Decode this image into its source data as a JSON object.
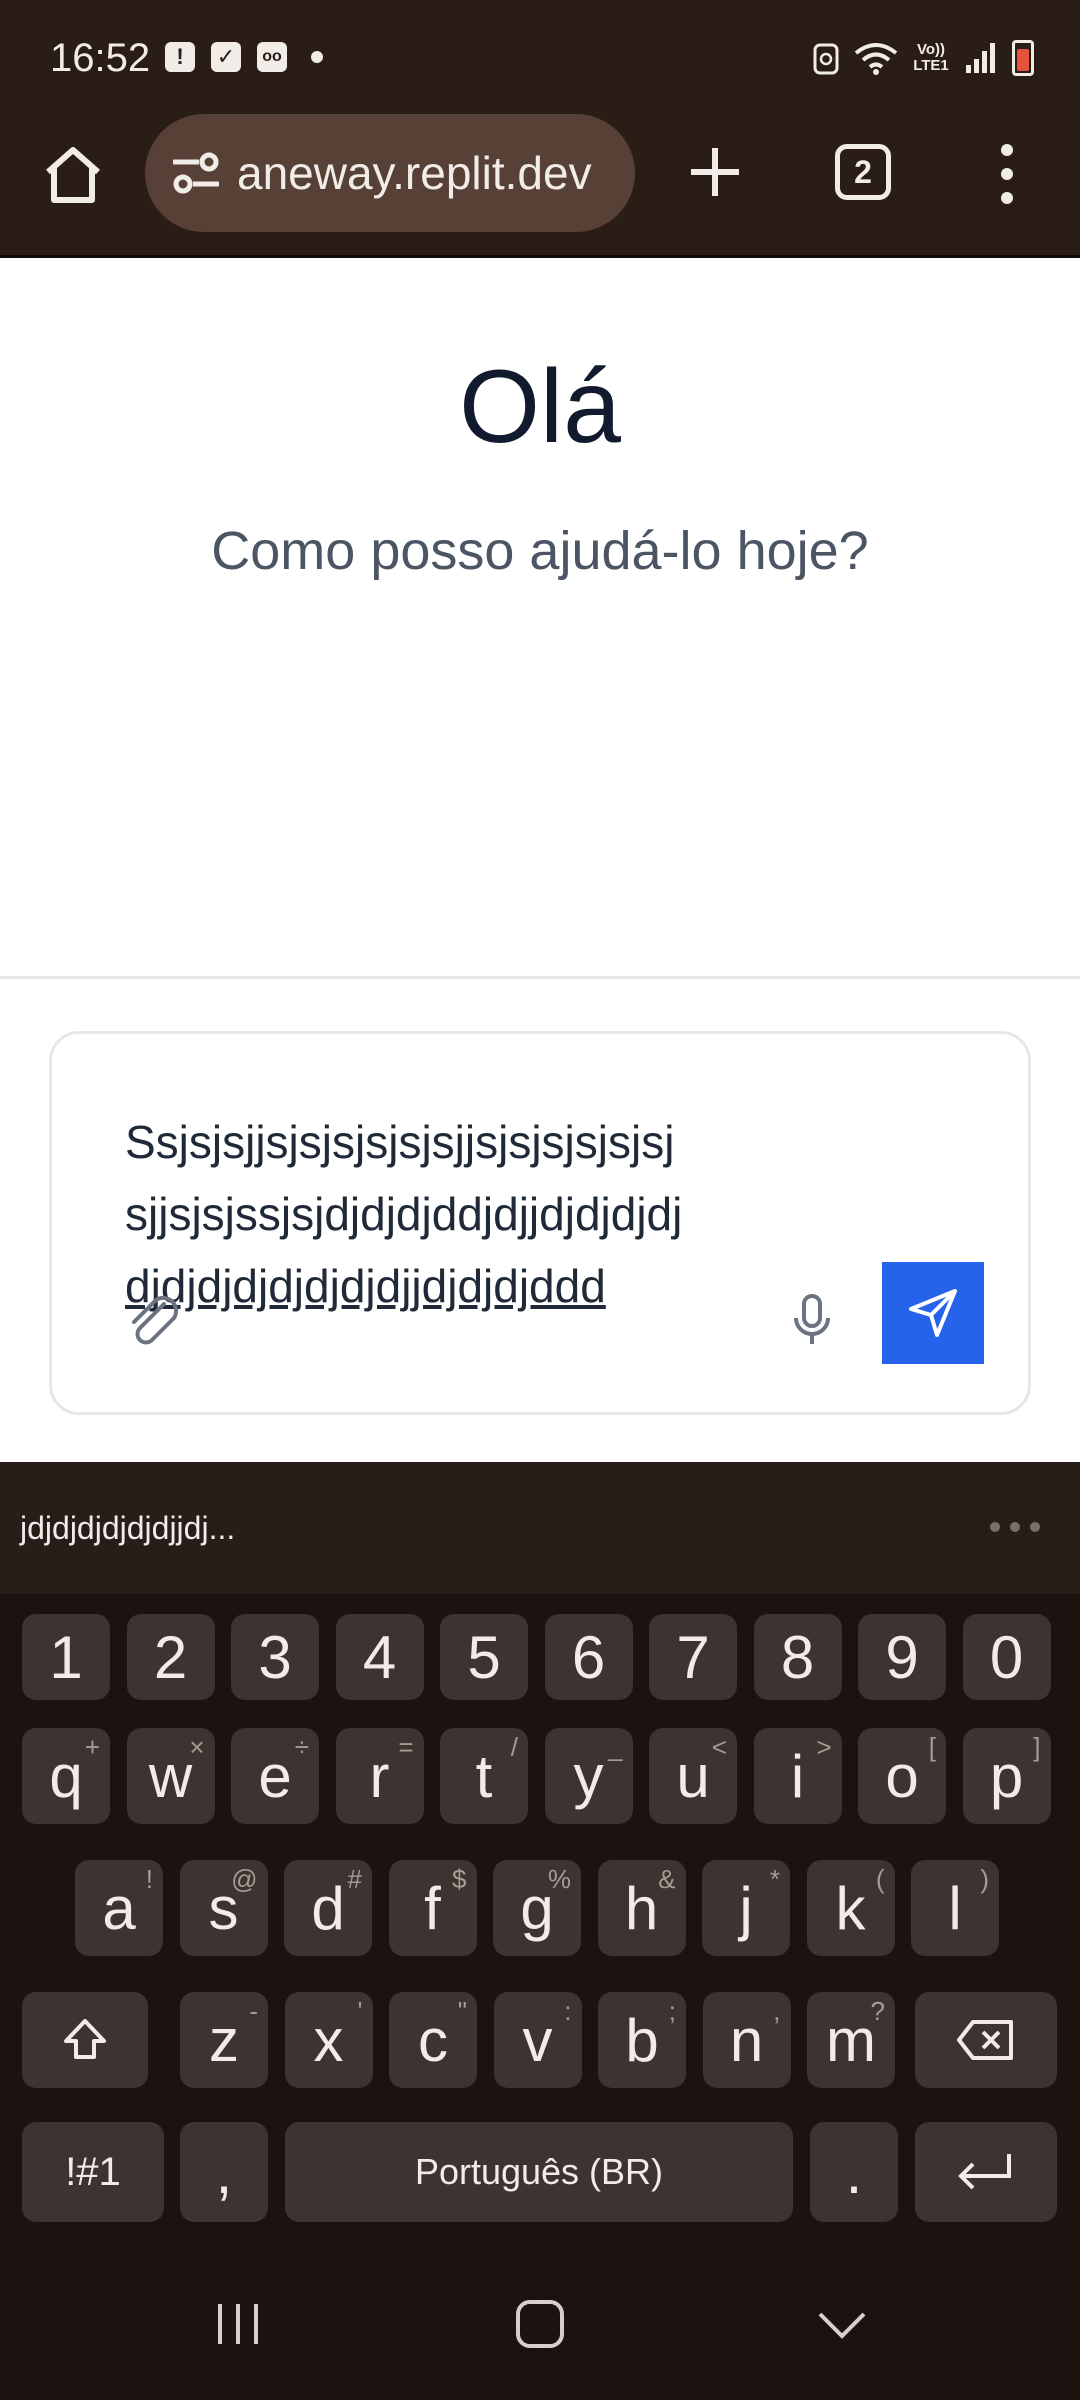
{
  "status_bar": {
    "time": "16:52",
    "left_icons": [
      "alert-icon",
      "check-icon",
      "voicemail-icon"
    ],
    "right_icons": [
      "recycle-icon",
      "wifi-icon",
      "lte-icon",
      "signal-icon",
      "battery-icon"
    ],
    "lte_label": "Vo)) LTE1"
  },
  "browser": {
    "url": "aneway.replit.dev",
    "tab_count": "2"
  },
  "page": {
    "greeting": "Olá",
    "subtitle": "Como posso ajudá-lo hoje?"
  },
  "composer": {
    "line1": "Ssjsjsjjsjsjsjsjsjsjjsjsjsjsjsjsj",
    "line2": "sjjsjsjssjsjdjdjdjddjdjjdjdjdjdj",
    "line3": "djdjdjdjdjdjdjdjjdjdjdjddd"
  },
  "keyboard": {
    "suggestion": "jdjdjdjdjdjdjjdj...",
    "number_row": [
      "1",
      "2",
      "3",
      "4",
      "5",
      "6",
      "7",
      "8",
      "9",
      "0"
    ],
    "row1": [
      {
        "k": "q",
        "s": "+"
      },
      {
        "k": "w",
        "s": "×"
      },
      {
        "k": "e",
        "s": "÷"
      },
      {
        "k": "r",
        "s": "="
      },
      {
        "k": "t",
        "s": "/"
      },
      {
        "k": "y",
        "s": "_"
      },
      {
        "k": "u",
        "s": "<"
      },
      {
        "k": "i",
        "s": ">"
      },
      {
        "k": "o",
        "s": "["
      },
      {
        "k": "p",
        "s": "]"
      }
    ],
    "row2": [
      {
        "k": "a",
        "s": "!"
      },
      {
        "k": "s",
        "s": "@"
      },
      {
        "k": "d",
        "s": "#"
      },
      {
        "k": "f",
        "s": "$"
      },
      {
        "k": "g",
        "s": "%"
      },
      {
        "k": "h",
        "s": "&"
      },
      {
        "k": "j",
        "s": "*"
      },
      {
        "k": "k",
        "s": "("
      },
      {
        "k": "l",
        "s": ")"
      }
    ],
    "row3": [
      {
        "k": "z",
        "s": "-"
      },
      {
        "k": "x",
        "s": "'"
      },
      {
        "k": "c",
        "s": "\""
      },
      {
        "k": "v",
        "s": ":"
      },
      {
        "k": "b",
        "s": ";"
      },
      {
        "k": "n",
        "s": ","
      },
      {
        "k": "m",
        "s": "?"
      }
    ],
    "symbols_label": "!#1",
    "comma_label": ",",
    "space_label": "Português (BR)",
    "period_label": "."
  }
}
